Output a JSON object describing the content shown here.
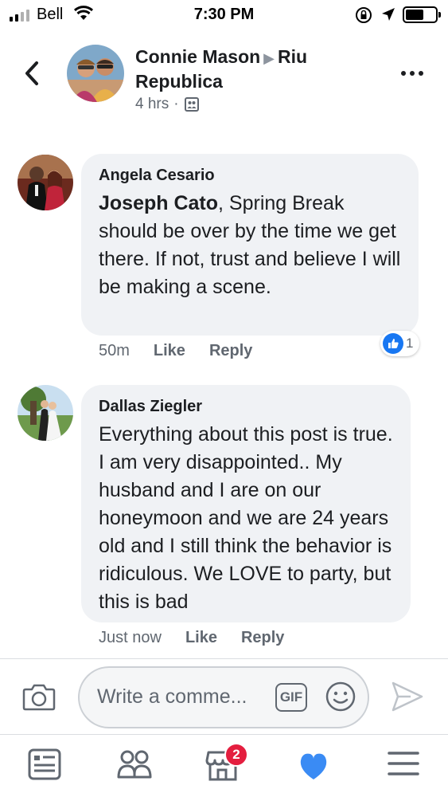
{
  "status_bar": {
    "carrier": "Bell",
    "time": "7:30 PM",
    "battery_level": 0.6
  },
  "post": {
    "author": "Connie Mason",
    "destination": "Riu Republica",
    "time": "4 hrs",
    "separator": "·"
  },
  "comments": [
    {
      "author": "Angela Cesario",
      "mention": "Joseph Cato",
      "text": ", Spring Break should be over by the time we get there. If not, trust and believe I will be making a scene.",
      "time": "50m",
      "like_label": "Like",
      "reply_label": "Reply",
      "reaction_count": "1"
    },
    {
      "author": "Dallas Ziegler",
      "text": "Everything about this post is true. I am very disappointed.. My husband and I are on our honeymoon and we are 24 years old and I still think the behavior is ridiculous. We LOVE to party, but this is bad",
      "time": "Just now",
      "like_label": "Like",
      "reply_label": "Reply"
    }
  ],
  "composer": {
    "placeholder": "Write a comme...",
    "gif_label": "GIF"
  },
  "tabbar": {
    "marketplace_badge": "2"
  },
  "colors": {
    "accent": "#1877f2",
    "badge": "#e41e3f",
    "bubble": "#f0f2f5",
    "muted": "#606770"
  },
  "icons": [
    "back-icon",
    "more-icon",
    "privacy-icon",
    "like-icon",
    "camera-icon",
    "gif-icon",
    "emoji-icon",
    "send-icon",
    "news-feed-icon",
    "groups-icon",
    "marketplace-icon",
    "dating-icon",
    "menu-icon"
  ]
}
